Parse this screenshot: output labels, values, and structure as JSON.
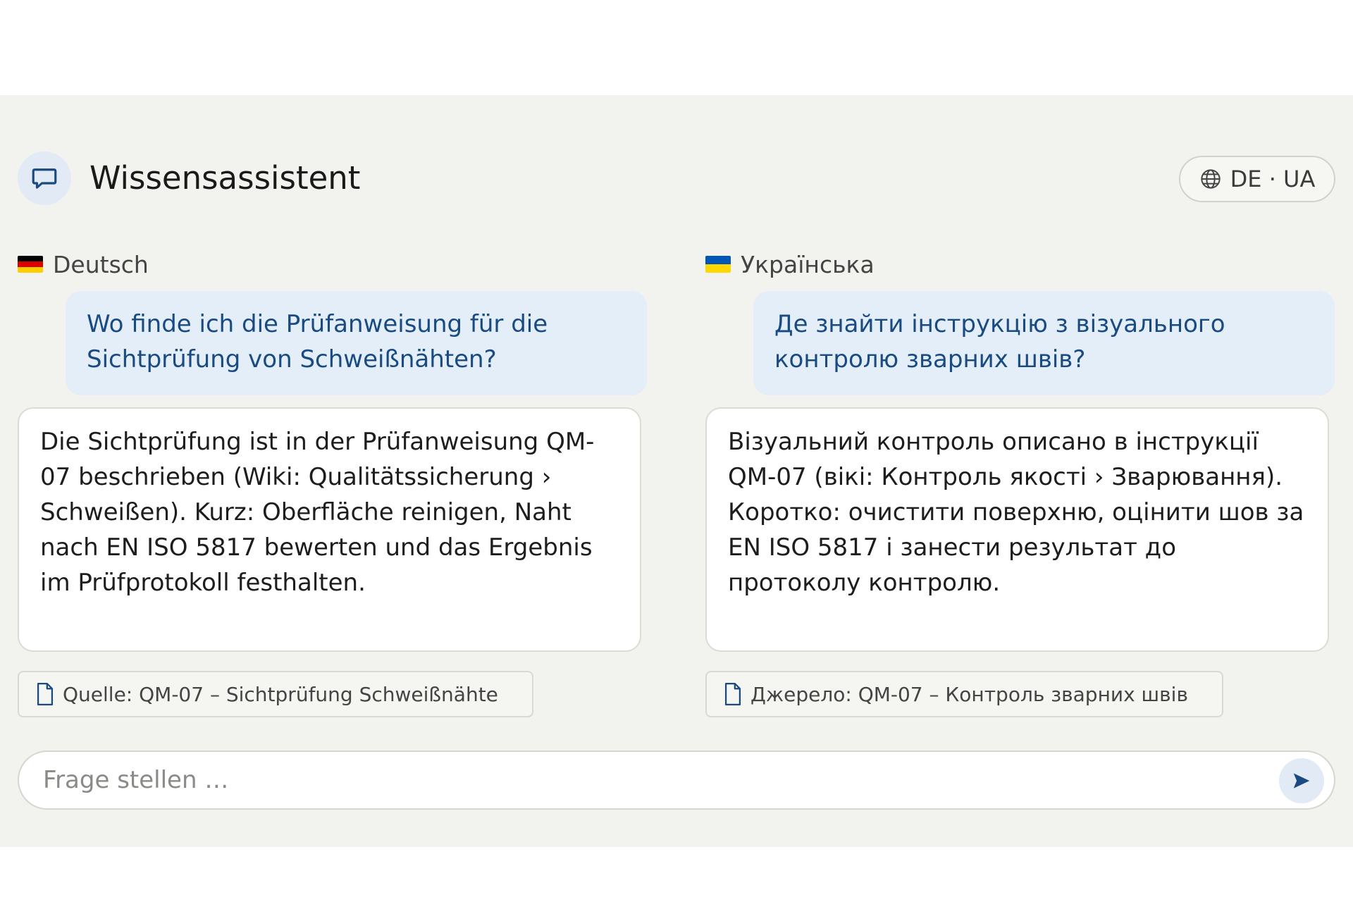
{
  "header": {
    "title": "Wissensassistent",
    "language_toggle": "DE · UA"
  },
  "columns": {
    "de": {
      "label": "Deutsch",
      "question": "Wo finde ich die Prüfanweisung für die Sichtprüfung von Schweißnähten?",
      "answer": "Die Sichtprüfung ist in der Prüfanweisung QM-07 beschrieben (Wiki: Qualitätssicherung › Schweißen). Kurz: Oberfläche reinigen, Naht nach EN ISO 5817 bewerten und das Ergebnis im Prüfprotokoll festhalten.",
      "source": "Quelle: QM-07 – Sichtprüfung Schweißnähte"
    },
    "ua": {
      "label": "Українська",
      "question": "Де знайти інструкцію з візуального контролю зварних швів?",
      "answer": "Візуальний контроль описано в інструкції QM-07 (вікі: Контроль якості › Зварювання). Коротко: очистити поверхню, оцінити шов за EN ISO 5817 і занести результат до протоколу контролю.",
      "source": "Джерело: QM-07 – Контроль зварних швів"
    }
  },
  "input": {
    "placeholder": "Frage stellen …"
  },
  "icons": {
    "logo": "chat-bubble-icon",
    "language": "globe-icon",
    "source": "document-icon",
    "send": "send-arrow-icon"
  },
  "colors": {
    "accent": "#1a4a82",
    "question_bg": "#e3eef9",
    "app_bg": "#f2f2ee"
  }
}
